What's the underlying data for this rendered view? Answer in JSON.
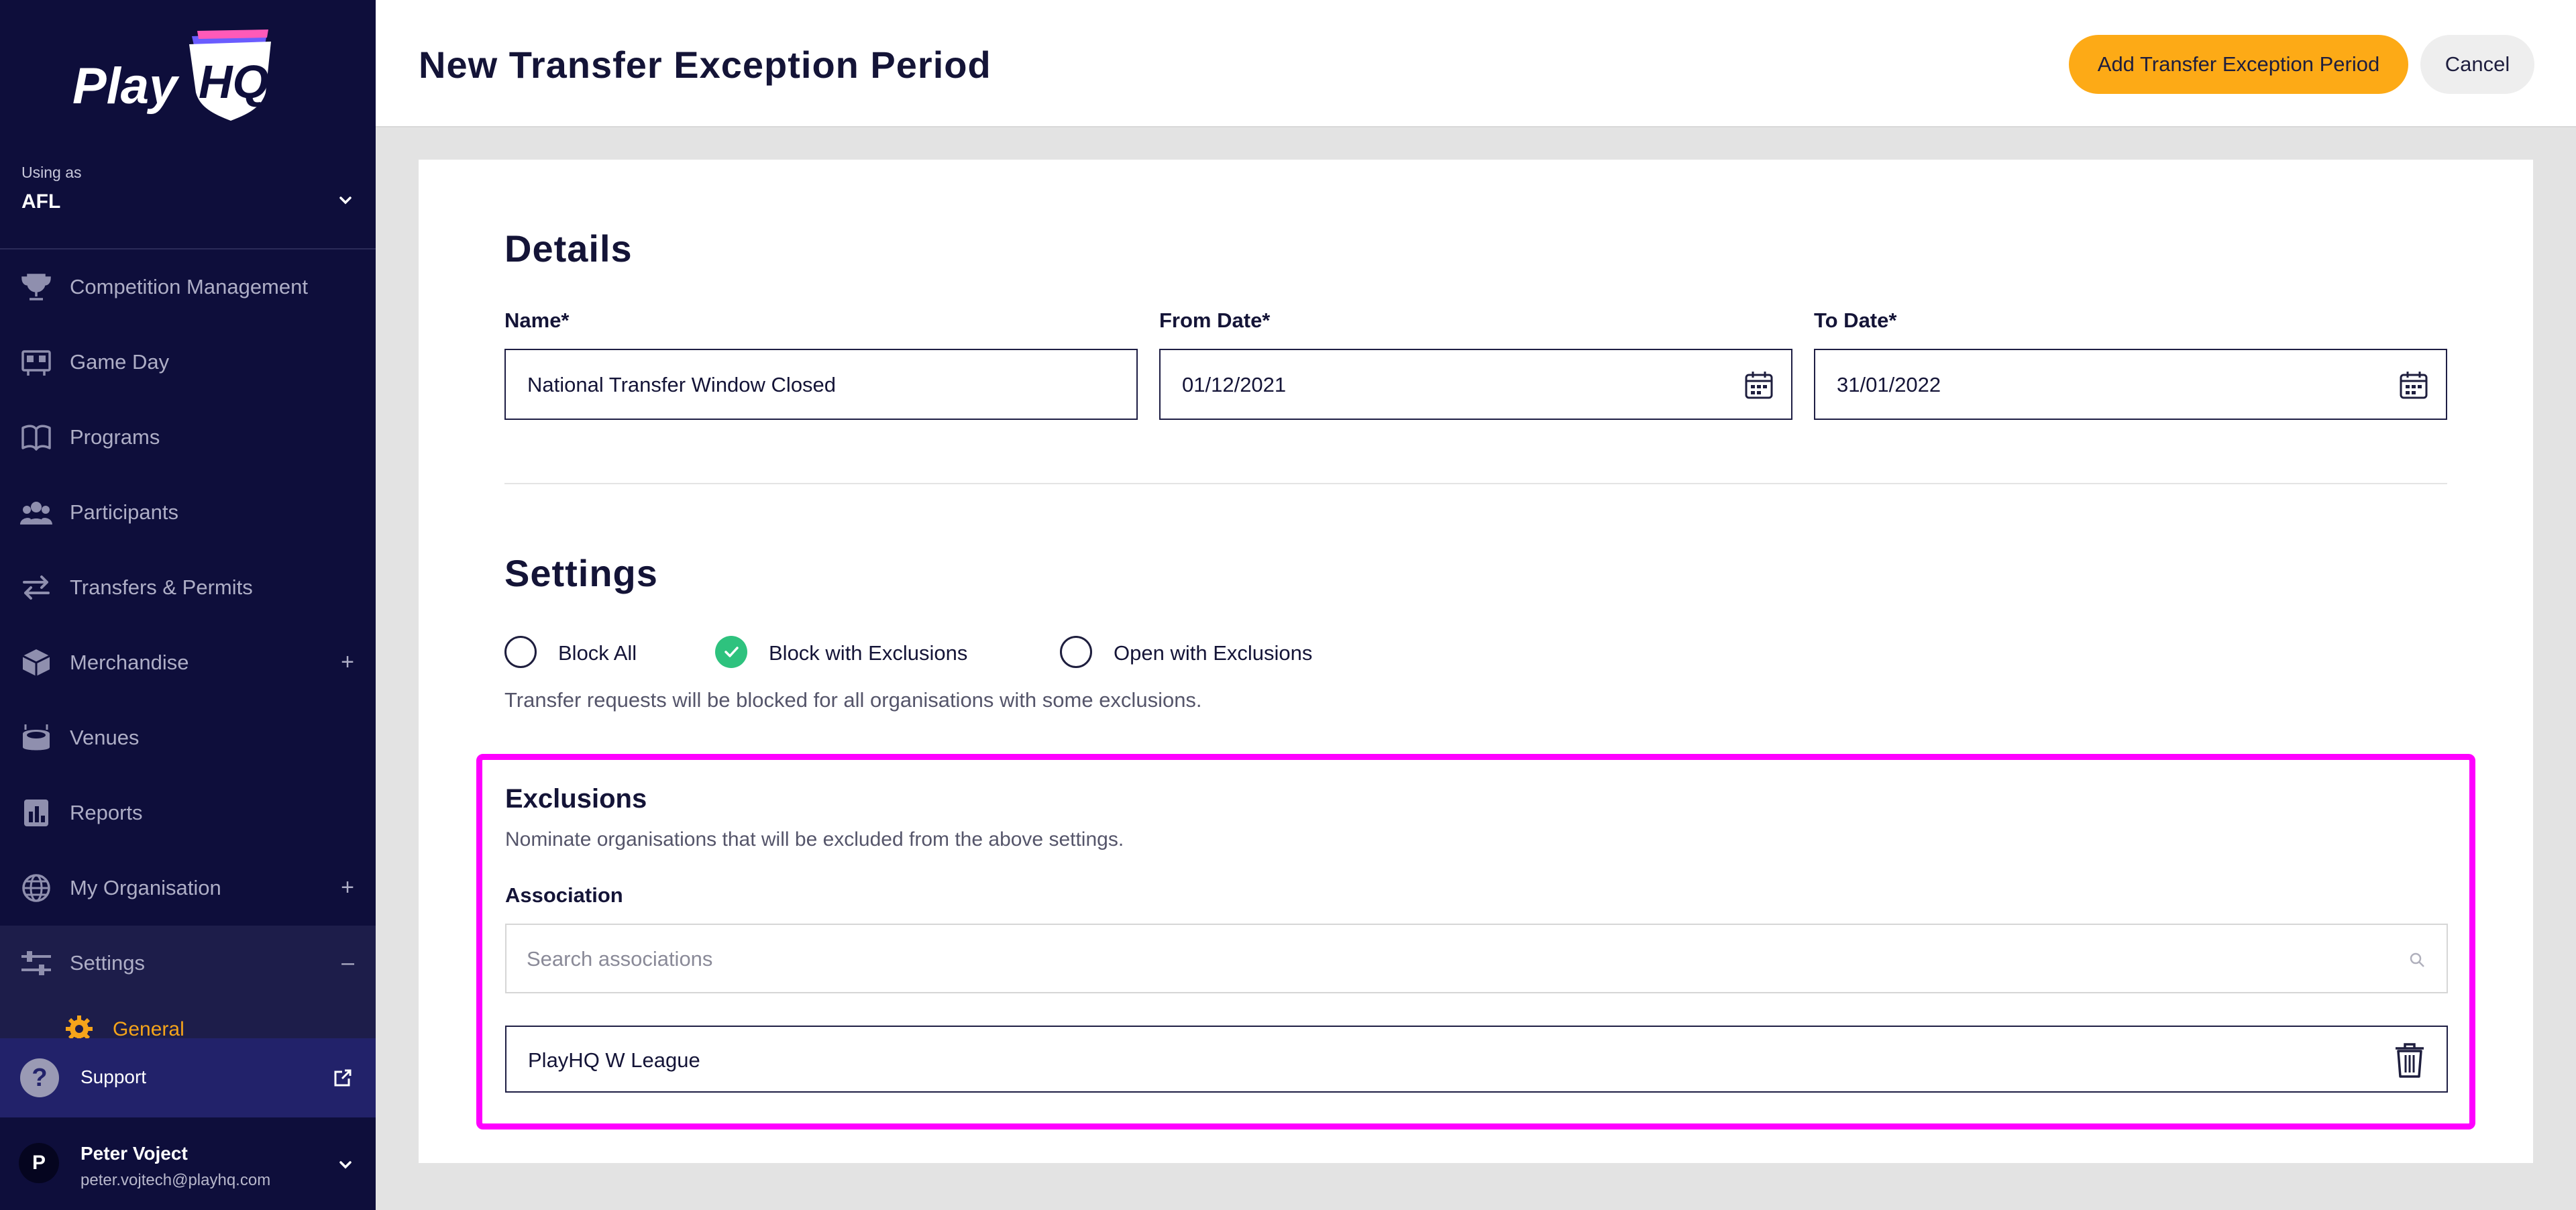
{
  "app": {
    "logo_text": "PlayHQ",
    "colors": {
      "sidebar": "#0e0e3b",
      "accent": "#fdaa16",
      "check": "#2ec27e",
      "highlight": "#ff00ff"
    }
  },
  "org": {
    "using_as": "Using as",
    "name": "AFL"
  },
  "nav": [
    {
      "label": "Competition Management",
      "icon": "trophy-icon"
    },
    {
      "label": "Game Day",
      "icon": "scoreboard-icon"
    },
    {
      "label": "Programs",
      "icon": "book-icon"
    },
    {
      "label": "Participants",
      "icon": "people-icon"
    },
    {
      "label": "Transfers & Permits",
      "icon": "transfer-arrows-icon"
    },
    {
      "label": "Merchandise",
      "icon": "box-icon",
      "toggle": "+"
    },
    {
      "label": "Venues",
      "icon": "stadium-icon"
    },
    {
      "label": "Reports",
      "icon": "report-icon"
    },
    {
      "label": "My Organisation",
      "icon": "globe-icon",
      "toggle": "+"
    },
    {
      "label": "Settings",
      "icon": "sliders-icon",
      "toggle": "–"
    }
  ],
  "nav_sub": {
    "label": "General",
    "icon": "gear-icon"
  },
  "support": {
    "label": "Support"
  },
  "user": {
    "initial": "P",
    "name": "Peter Vojтect",
    "email": "peter.vojtech@playhq.com"
  },
  "header": {
    "title": "New Transfer Exception Period",
    "primary_button": "Add Transfer Exception Period",
    "cancel_button": "Cancel"
  },
  "details": {
    "title": "Details",
    "name_label": "Name*",
    "name_value": "National Transfer Window Closed",
    "from_label": "From Date*",
    "from_value": "01/12/2021",
    "to_label": "To Date*",
    "to_value": "31/01/2022"
  },
  "settings": {
    "title": "Settings",
    "options": [
      {
        "label": "Block All",
        "checked": false
      },
      {
        "label": "Block with Exclusions",
        "checked": true
      },
      {
        "label": "Open with Exclusions",
        "checked": false
      }
    ],
    "helper": "Transfer requests will be blocked for all organisations with some exclusions."
  },
  "exclusions": {
    "title": "Exclusions",
    "description": "Nominate organisations that will be excluded from the above settings.",
    "association_label": "Association",
    "search_placeholder": "Search associations",
    "items": [
      "PlayHQ W League"
    ]
  }
}
